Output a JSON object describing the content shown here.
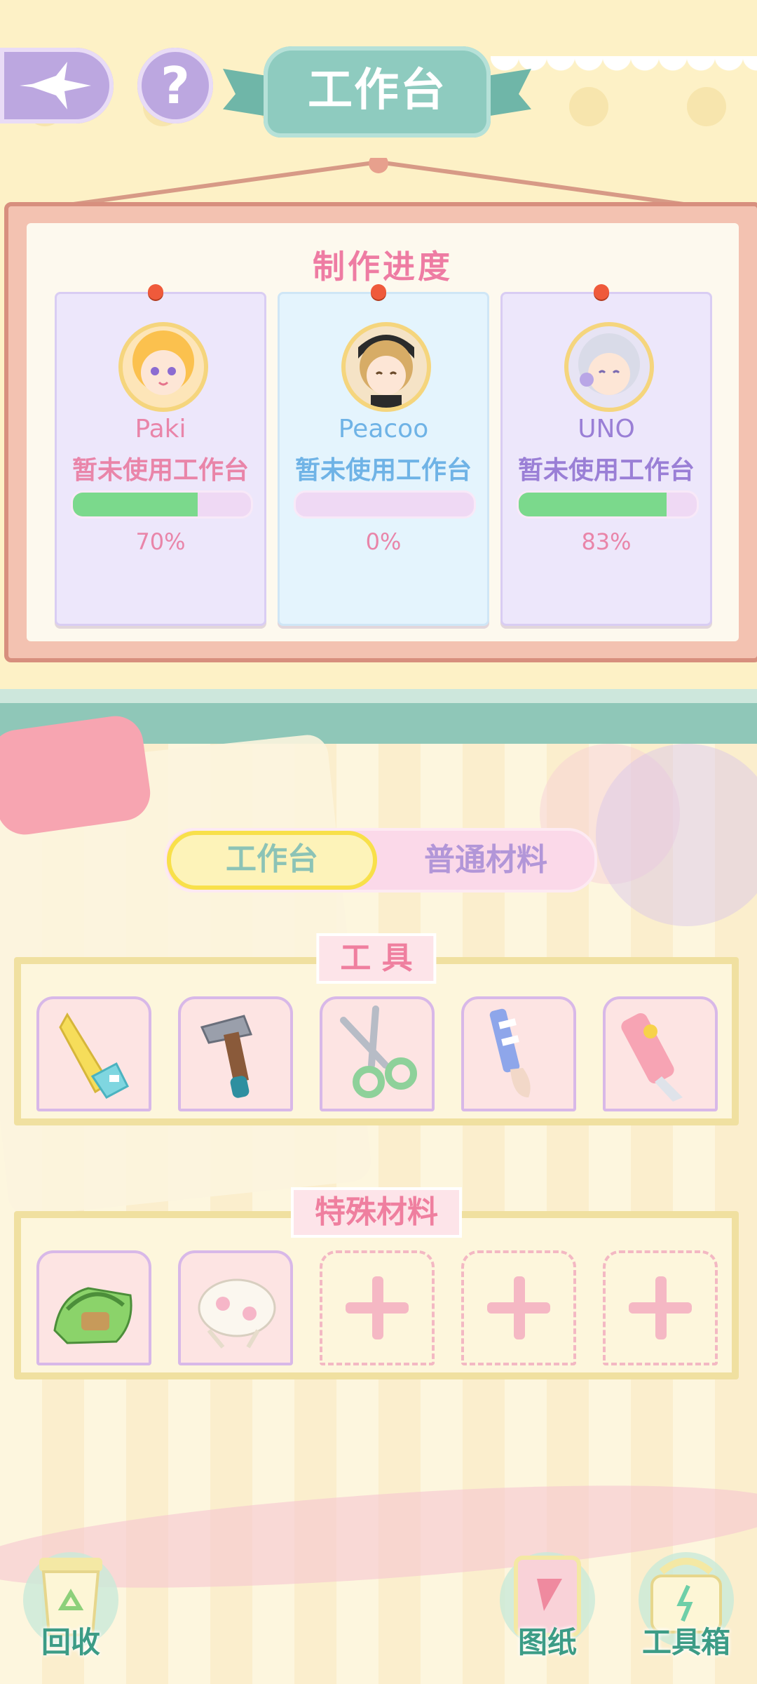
{
  "header": {
    "title": "工作台",
    "help_glyph": "?",
    "back_icon": "back-star-icon"
  },
  "progress_board": {
    "title": "制作进度",
    "cards": [
      {
        "name": "Paki",
        "status": "暂未使用工作台",
        "progress_label": "70%",
        "progress": 0.7,
        "name_color": "#e985a9"
      },
      {
        "name": "Peacoo",
        "status": "暂未使用工作台",
        "progress_label": "0%",
        "progress": 0.0,
        "name_color": "#6fb3e6"
      },
      {
        "name": "UNO",
        "status": "暂未使用工作台",
        "progress_label": "83%",
        "progress": 0.83,
        "name_color": "#9a7fd6"
      }
    ]
  },
  "tabs": {
    "workbench": "工作台",
    "materials": "普通材料"
  },
  "tools_section": {
    "label": "工 具",
    "items": [
      "saw-icon",
      "hammer-icon",
      "scissors-icon",
      "brush-icon",
      "utility-knife-icon"
    ]
  },
  "special_section": {
    "label": "特殊材料",
    "items": [
      "green-bag-icon",
      "lace-bonnet-icon",
      "empty",
      "empty",
      "empty"
    ]
  },
  "bottom_nav": {
    "recycle": "回收",
    "blueprint": "图纸",
    "toolbox": "工具箱"
  },
  "colors": {
    "accent_teal": "#8fc7b8",
    "accent_pink": "#ee7ca3",
    "progress_green": "#7bd98c"
  }
}
